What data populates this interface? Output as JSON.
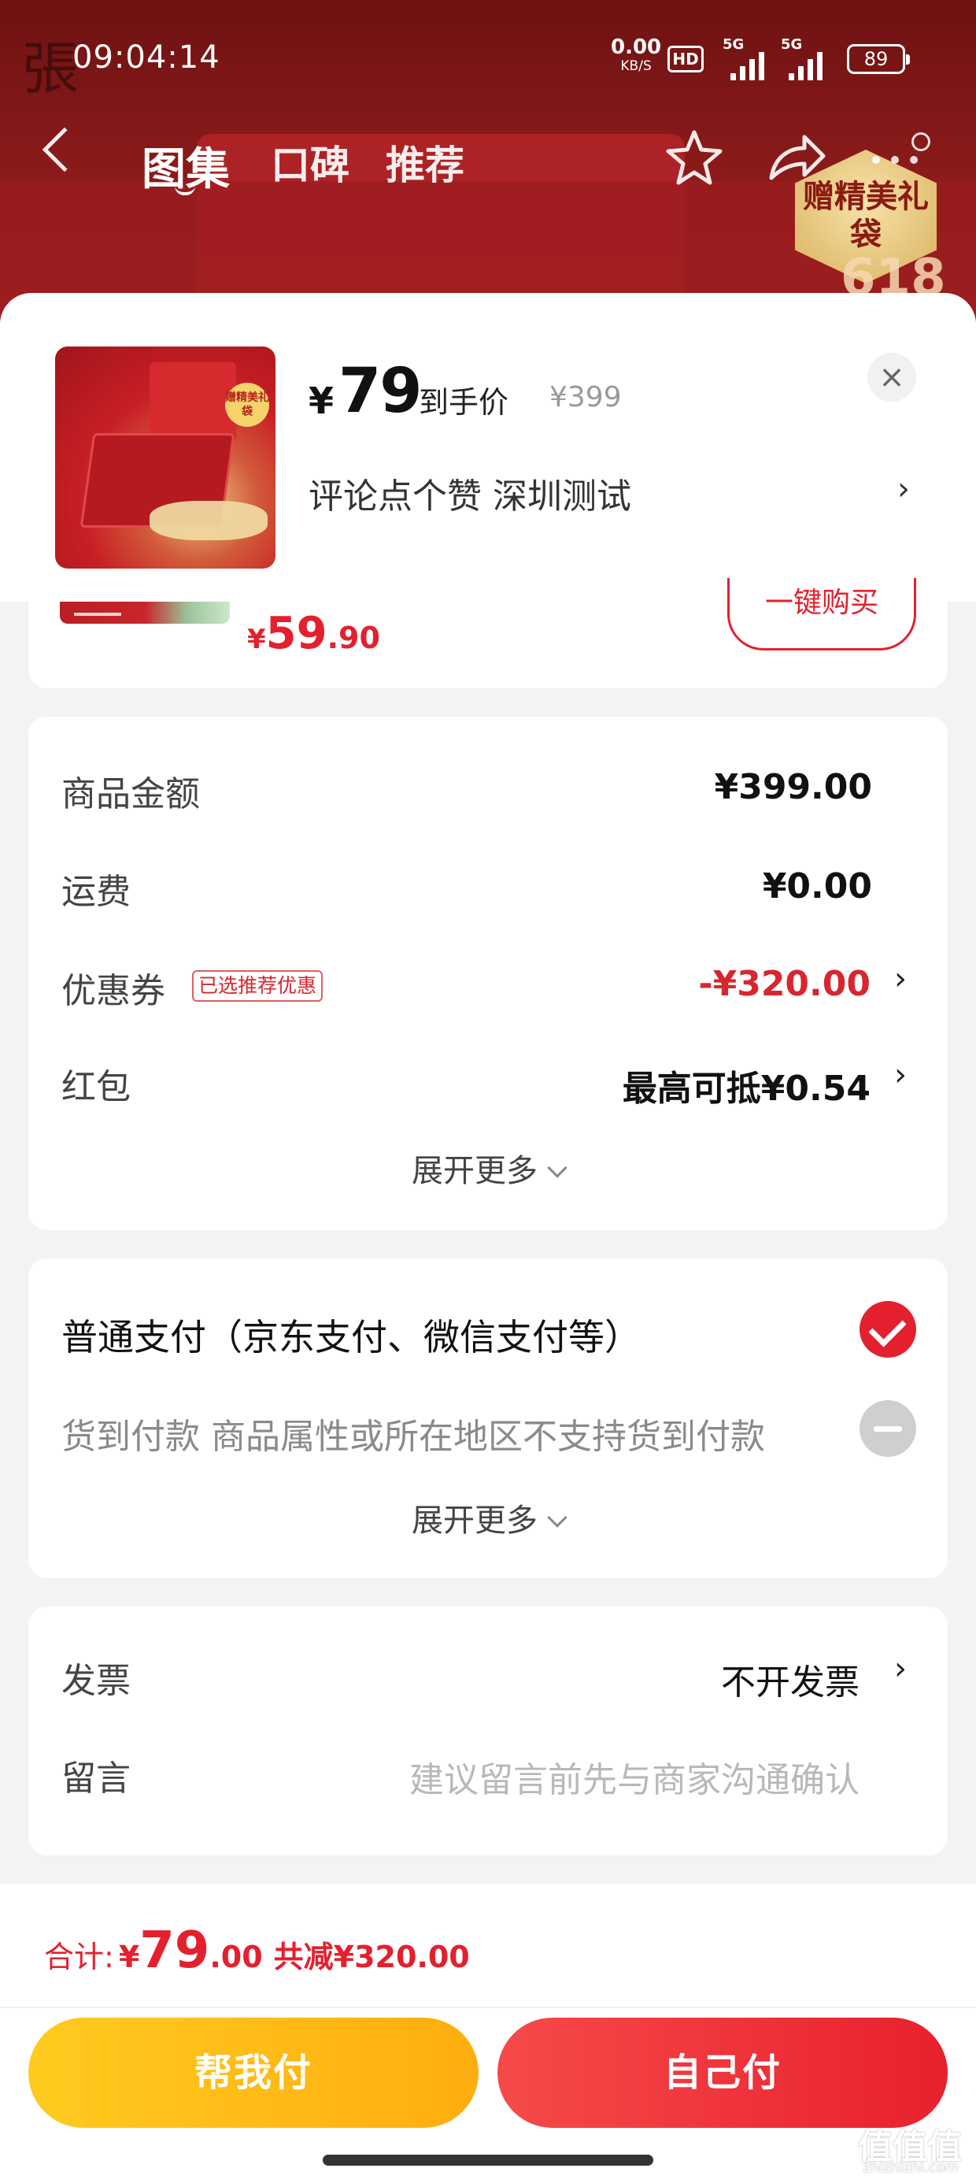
{
  "status_bar": {
    "time": "09:04:14",
    "net_speed": "0.00",
    "net_unit": "KB/S",
    "hd": "HD",
    "sim1": "5G",
    "sim2": "5G",
    "battery": "89"
  },
  "header": {
    "logo_char": "張",
    "tabs": [
      {
        "label": "图集",
        "active": true
      },
      {
        "label": "口碑"
      },
      {
        "label": "推荐"
      }
    ],
    "gift_badge": "赠精美礼袋",
    "promo_badge": "618"
  },
  "product": {
    "currency": "¥",
    "price": "79",
    "price_label": "到手价",
    "original_price": "¥399",
    "desc": "评论点个赞  深圳测试",
    "close": "×",
    "thumb_seal": "赠精美礼袋"
  },
  "recommended_item": {
    "currency": "¥",
    "price_int": "59",
    "price_dec": ".90",
    "buy_label": "一键购买"
  },
  "order_summary": {
    "goods_amount_label": "商品金额",
    "goods_amount": "¥399.00",
    "shipping_label": "运费",
    "shipping": "¥0.00",
    "coupon_label": "优惠券",
    "coupon_tag": "已选推荐优惠",
    "coupon_value": "-¥320.00",
    "redpacket_label": "红包",
    "redpacket_value": "最高可抵¥0.54",
    "expand": "展开更多"
  },
  "payment": {
    "normal": "普通支付（京东支付、微信支付等）",
    "cod": "货到付款 商品属性或所在地区不支持货到付款",
    "expand": "展开更多"
  },
  "extra": {
    "invoice_label": "发票",
    "invoice_value": "不开发票",
    "message_label": "留言",
    "message_placeholder": "建议留言前先与商家沟通确认"
  },
  "footer": {
    "total_label": "合计:",
    "currency": "¥",
    "total_int": "79",
    "total_dec": ".00",
    "discount": "共减¥320.00",
    "help_pay": "帮我付",
    "self_pay": "自己付"
  },
  "watermark": {
    "text": "值值值",
    "sub": "zhizhizhi.com"
  },
  "colors": {
    "accent": "#e4202e",
    "yellow": "#ffb914",
    "header_red": "#8a1a1a"
  }
}
